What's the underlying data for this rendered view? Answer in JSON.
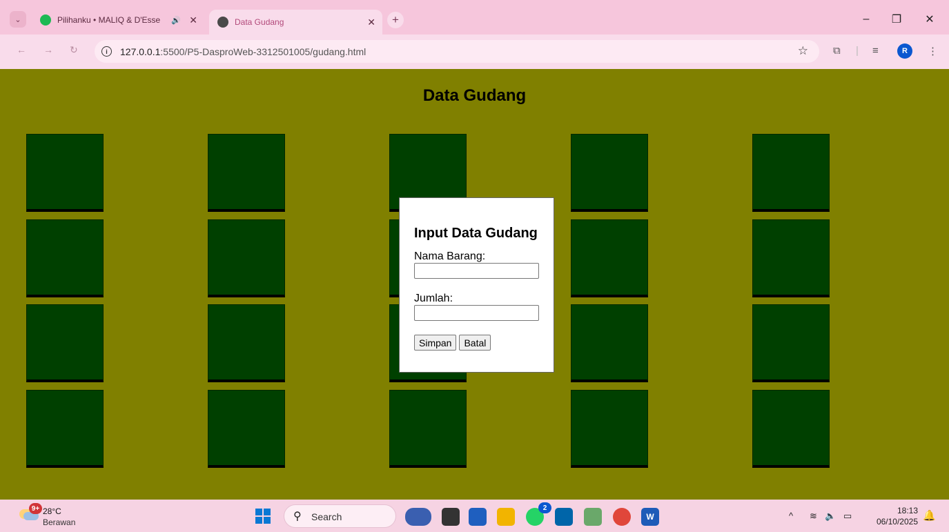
{
  "browser": {
    "tabs": [
      {
        "title": "Pilihanku • MALIQ & D'Esse",
        "active": false,
        "audio": true
      },
      {
        "title": "Data Gudang",
        "active": true
      }
    ],
    "new_tab": "+",
    "url_host": "127.0.0.1",
    "url_rest": ":5500/P5-DasproWeb-3312501005/gudang.html",
    "profile_initial": "R",
    "window": {
      "minimize": "–",
      "restore": "❐",
      "close": "✕"
    }
  },
  "page": {
    "title": "Data Gudang",
    "background": "#808000",
    "box_color": "#004000"
  },
  "modal": {
    "heading": "Input Data Gudang",
    "nama_label": "Nama Barang:",
    "nama_value": "",
    "jumlah_label": "Jumlah:",
    "jumlah_value": "",
    "save_label": "Simpan",
    "cancel_label": "Batal"
  },
  "taskbar": {
    "weather_badge": "9+",
    "temperature": "28°C",
    "condition": "Berawan",
    "search_placeholder": "Search",
    "whatsapp_badge": "2",
    "time": "18:13",
    "date": "06/10/2025"
  }
}
